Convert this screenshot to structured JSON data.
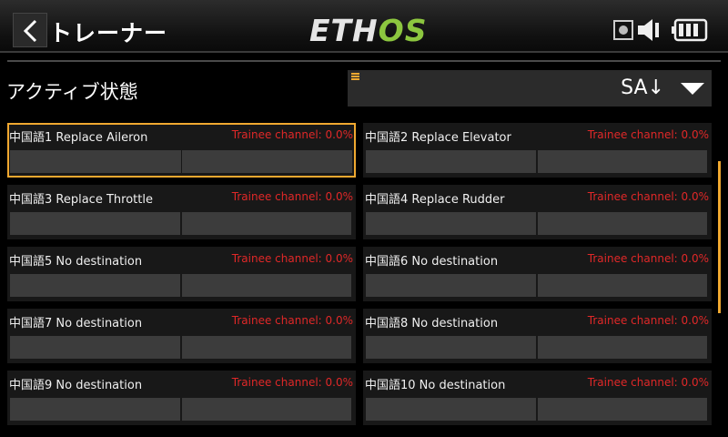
{
  "header": {
    "back_icon": "chevron-left-icon",
    "title": "トレーナー",
    "logo_main": "ETH",
    "logo_accent": "OS",
    "logo_accent_color": "#8cc63f"
  },
  "status_icons": [
    "record-icon",
    "speaker-icon",
    "battery-icon"
  ],
  "active_state": {
    "label": "アクティブ状態",
    "value": "SA↓"
  },
  "channels": [
    {
      "name": "中国語1 Replace Aileron",
      "status": "Trainee channel: 0.0%"
    },
    {
      "name": "中国語2 Replace Elevator",
      "status": "Trainee channel: 0.0%"
    },
    {
      "name": "中国語3 Replace Throttle",
      "status": "Trainee channel: 0.0%"
    },
    {
      "name": "中国語4 Replace Rudder",
      "status": "Trainee channel: 0.0%"
    },
    {
      "name": "中国語5 No destination",
      "status": "Trainee channel: 0.0%"
    },
    {
      "name": "中国語6 No destination",
      "status": "Trainee channel: 0.0%"
    },
    {
      "name": "中国語7 No destination",
      "status": "Trainee channel: 0.0%"
    },
    {
      "name": "中国語8 No destination",
      "status": "Trainee channel: 0.0%"
    },
    {
      "name": "中国語9 No destination",
      "status": "Trainee channel: 0.0%"
    },
    {
      "name": "中国語10 No destination",
      "status": "Trainee channel: 0.0%"
    }
  ],
  "colors": {
    "accent": "#f0a830",
    "status_text": "#e02828"
  }
}
